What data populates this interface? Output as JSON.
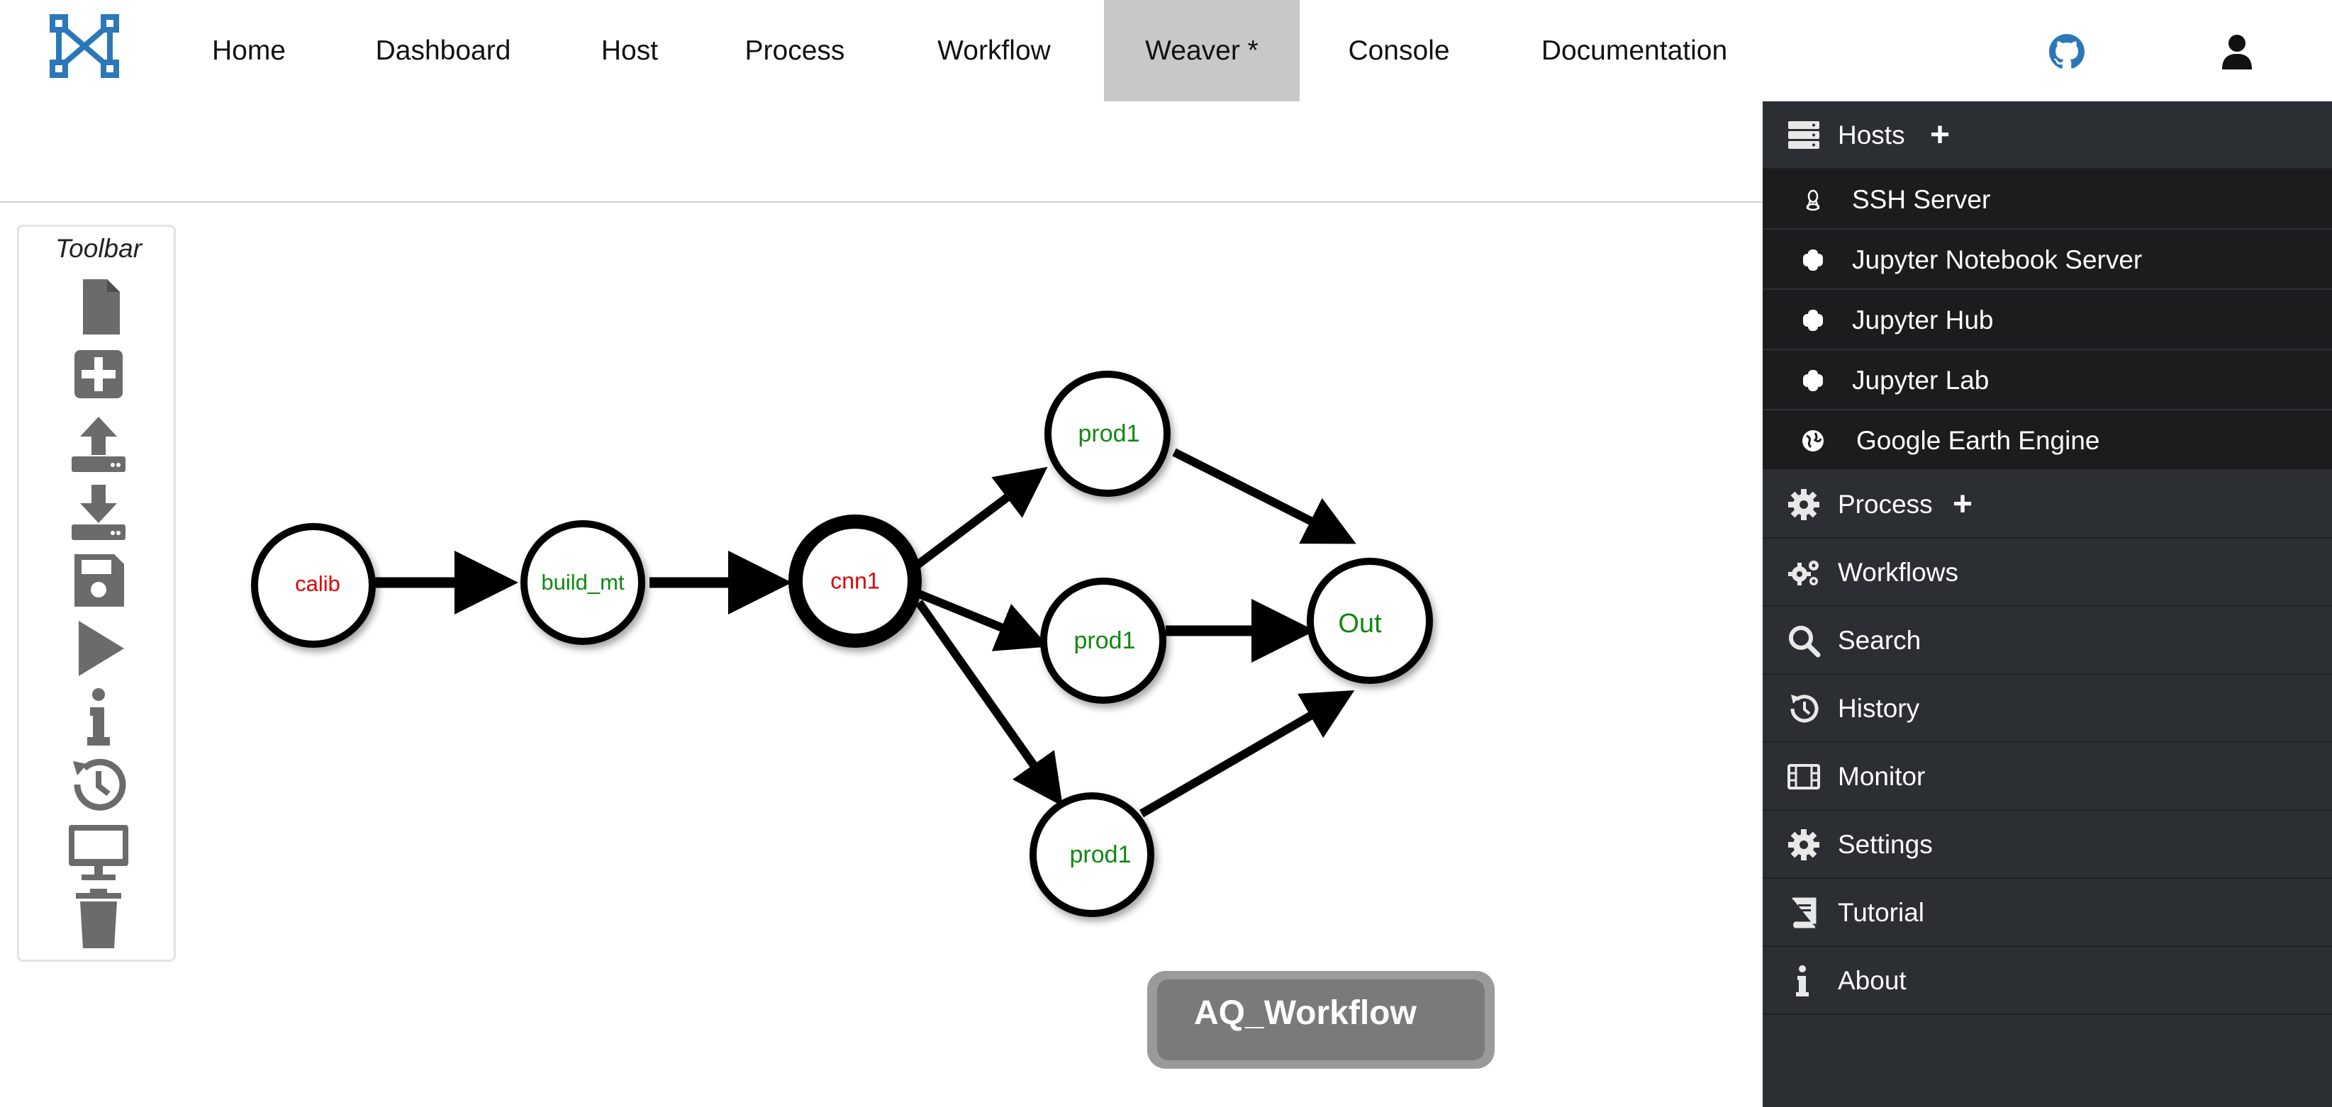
{
  "nav": {
    "items": [
      "Home",
      "Dashboard",
      "Host",
      "Process",
      "Workflow",
      "Weaver *",
      "Console",
      "Documentation"
    ],
    "active": "Weaver *",
    "logo_icon": "x-network-logo",
    "github_icon": "github-icon",
    "user_icon": "user-icon",
    "logo_color": "#2a78b8"
  },
  "toolbar": {
    "title": "Toolbar",
    "tools": [
      "new-file-icon",
      "add-icon",
      "upload-icon",
      "download-icon",
      "save-icon",
      "run-icon",
      "info-icon",
      "history-icon",
      "monitor-icon",
      "trash-icon"
    ]
  },
  "graph": {
    "nodes": [
      {
        "id": "calib",
        "label": "calib",
        "color": "#e00000"
      },
      {
        "id": "build_mt",
        "label": "build_mt",
        "color": "#118811"
      },
      {
        "id": "cnn1",
        "label": "cnn1",
        "color": "#e00000",
        "selected": true
      },
      {
        "id": "prod1_top",
        "label": "prod1",
        "color": "#118811"
      },
      {
        "id": "prod1_mid",
        "label": "prod1",
        "color": "#118811"
      },
      {
        "id": "prod1_bot",
        "label": "prod1",
        "color": "#118811"
      },
      {
        "id": "out",
        "label": "Out",
        "color": "#118811"
      }
    ],
    "edges": [
      [
        "calib",
        "build_mt"
      ],
      [
        "build_mt",
        "cnn1"
      ],
      [
        "cnn1",
        "prod1_top"
      ],
      [
        "cnn1",
        "prod1_mid"
      ],
      [
        "cnn1",
        "prod1_bot"
      ],
      [
        "prod1_top",
        "out"
      ],
      [
        "prod1_mid",
        "out"
      ],
      [
        "prod1_bot",
        "out"
      ]
    ]
  },
  "workflow_name": "AQ_Workflow",
  "sidebar": {
    "hosts": {
      "label": "Hosts",
      "icon": "server-icon",
      "add": "+"
    },
    "host_items": [
      {
        "label": "SSH Server",
        "icon": "linux-icon"
      },
      {
        "label": "Jupyter Notebook Server",
        "icon": "python-icon"
      },
      {
        "label": "Jupyter Hub",
        "icon": "python-icon"
      },
      {
        "label": "Jupyter Lab",
        "icon": "python-icon"
      },
      {
        "label": "Google Earth Engine",
        "icon": "globe-icon"
      }
    ],
    "process": {
      "label": "Process",
      "icon": "gear-icon",
      "add": "+"
    },
    "items": [
      {
        "label": "Workflows",
        "icon": "gears-icon"
      },
      {
        "label": "Search",
        "icon": "search-icon"
      },
      {
        "label": "History",
        "icon": "history-icon"
      },
      {
        "label": "Monitor",
        "icon": "film-icon"
      },
      {
        "label": "Settings",
        "icon": "settings-icon"
      },
      {
        "label": "Tutorial",
        "icon": "book-icon"
      },
      {
        "label": "About",
        "icon": "info-icon"
      }
    ]
  }
}
